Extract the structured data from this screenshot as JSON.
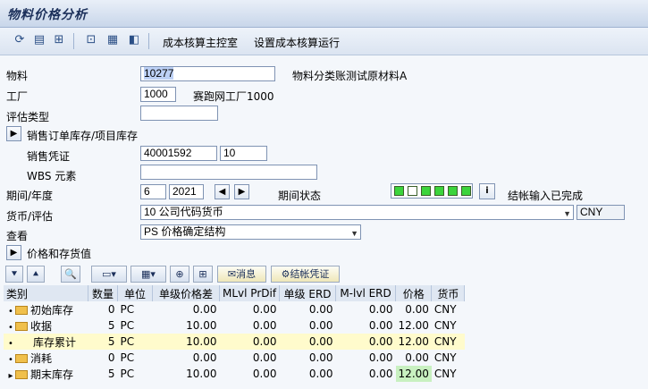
{
  "title": "物料价格分析",
  "toolbar": {
    "icons": [
      "refresh-icon",
      "layout-icon",
      "hierarchy-icon",
      "cost-icon",
      "calculator-icon",
      "print-icon"
    ],
    "link1": "成本核算主控室",
    "link2": "设置成本核算运行"
  },
  "form": {
    "material_label": "物料",
    "material_value": "10277",
    "material_desc": "物料分类账测试原材料A",
    "plant_label": "工厂",
    "plant_value": "1000",
    "plant_desc": "赛跑网工厂1000",
    "valtype_label": "评估类型",
    "valtype_value": "",
    "sales_stock_label": "销售订单库存/项目库存",
    "sales_doc_label": "销售凭证",
    "sales_doc_value": "40001592",
    "sales_item_value": "10",
    "wbs_label": "WBS 元素",
    "wbs_value": "",
    "period_label": "期间/年度",
    "period_value": "6",
    "year_value": "2021",
    "period_status_label": "期间状态",
    "period_status_text": "结帐输入已完成",
    "currency_label": "货币/评估",
    "currency_value": "10 公司代码货币",
    "currency_code": "CNY",
    "view_label": "查看",
    "view_value": "PS 价格确定结构",
    "prices_label": "价格和存货值"
  },
  "grid_toolbar": {
    "message_label": "消息",
    "closing_label": "结帐凭证"
  },
  "table": {
    "headers": [
      "类别",
      "数量",
      "单位",
      "单级价格差",
      "MLvl PrDif",
      "单级 ERD",
      "M-lvl ERD",
      "价格",
      "货币"
    ],
    "rows": [
      {
        "cat": "初始库存",
        "qty": "0",
        "unit": "PC",
        "sl_diff": "0.00",
        "ml_diff": "0.00",
        "sl_erd": "0.00",
        "ml_erd": "0.00",
        "price": "0.00",
        "cur": "CNY"
      },
      {
        "cat": "收据",
        "qty": "5",
        "unit": "PC",
        "sl_diff": "10.00",
        "ml_diff": "0.00",
        "sl_erd": "0.00",
        "ml_erd": "0.00",
        "price": "12.00",
        "cur": "CNY"
      },
      {
        "cat": "库存累计",
        "qty": "5",
        "unit": "PC",
        "sl_diff": "10.00",
        "ml_diff": "0.00",
        "sl_erd": "0.00",
        "ml_erd": "0.00",
        "price": "12.00",
        "cur": "CNY"
      },
      {
        "cat": "消耗",
        "qty": "0",
        "unit": "PC",
        "sl_diff": "0.00",
        "ml_diff": "0.00",
        "sl_erd": "0.00",
        "ml_erd": "0.00",
        "price": "0.00",
        "cur": "CNY"
      },
      {
        "cat": "期末库存",
        "qty": "5",
        "unit": "PC",
        "sl_diff": "10.00",
        "ml_diff": "0.00",
        "sl_erd": "0.00",
        "ml_erd": "0.00",
        "price": "12.00",
        "cur": "CNY"
      }
    ]
  }
}
